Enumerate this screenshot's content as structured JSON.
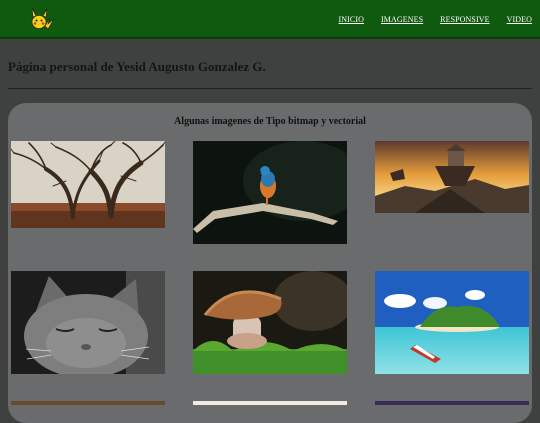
{
  "header": {
    "logo_icon": "pikachu-icon",
    "nav": [
      "INICIO",
      "IMAGENES",
      "RESPONSIVE",
      "VIDEO"
    ]
  },
  "main": {
    "page_title": "Página personal de Yesid Augusto Gonzalez G.",
    "section_title": "Algunas imagenes de Tipo bitmap y vectorial",
    "images": [
      {
        "subject": "tree-image"
      },
      {
        "subject": "kingfisher-bird-image"
      },
      {
        "subject": "floating-island-sunset-image"
      },
      {
        "subject": "sleeping-cat-image"
      },
      {
        "subject": "mushroom-image"
      },
      {
        "subject": "tropical-island-boat-image"
      }
    ]
  },
  "colors": {
    "header_bg": "#0f5a0f",
    "page_bg": "#3f4141",
    "panel_bg": "#696b6c"
  }
}
